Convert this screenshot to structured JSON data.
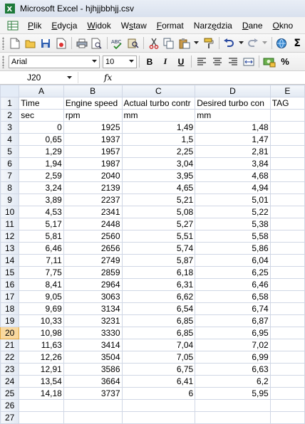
{
  "window": {
    "title": "Microsoft Excel - hjhjjbbhjj.csv"
  },
  "menu": [
    {
      "pre": "",
      "u": "P",
      "post": "lik"
    },
    {
      "pre": "",
      "u": "E",
      "post": "dycja"
    },
    {
      "pre": "",
      "u": "W",
      "post": "idok"
    },
    {
      "pre": "W",
      "u": "s",
      "post": "taw"
    },
    {
      "pre": "",
      "u": "F",
      "post": "ormat"
    },
    {
      "pre": "Narz",
      "u": "ę",
      "post": "dzia"
    },
    {
      "pre": "",
      "u": "D",
      "post": "ane"
    },
    {
      "pre": "",
      "u": "O",
      "post": "kno"
    }
  ],
  "format_toolbar": {
    "font": "Arial",
    "size": "10",
    "bold": "B",
    "italic": "I",
    "underline": "U"
  },
  "formula_bar": {
    "cell_ref": "J20",
    "fx": "fx",
    "content": ""
  },
  "columns": [
    "A",
    "B",
    "C",
    "D",
    "E"
  ],
  "active_row": 20,
  "rows": [
    [
      "Time",
      "Engine speed",
      "Actual turbo contr",
      "Desired turbo con",
      "TAG"
    ],
    [
      "sec",
      "rpm",
      "mm",
      "mm",
      ""
    ],
    [
      "0",
      "1925",
      "1,49",
      "1,48",
      ""
    ],
    [
      "0,65",
      "1937",
      "1,5",
      "1,47",
      ""
    ],
    [
      "1,29",
      "1957",
      "2,25",
      "2,81",
      ""
    ],
    [
      "1,94",
      "1987",
      "3,04",
      "3,84",
      ""
    ],
    [
      "2,59",
      "2040",
      "3,95",
      "4,68",
      ""
    ],
    [
      "3,24",
      "2139",
      "4,65",
      "4,94",
      ""
    ],
    [
      "3,89",
      "2237",
      "5,21",
      "5,01",
      ""
    ],
    [
      "4,53",
      "2341",
      "5,08",
      "5,22",
      ""
    ],
    [
      "5,17",
      "2448",
      "5,27",
      "5,38",
      ""
    ],
    [
      "5,81",
      "2560",
      "5,51",
      "5,58",
      ""
    ],
    [
      "6,46",
      "2656",
      "5,74",
      "5,86",
      ""
    ],
    [
      "7,11",
      "2749",
      "5,87",
      "6,04",
      ""
    ],
    [
      "7,75",
      "2859",
      "6,18",
      "6,25",
      ""
    ],
    [
      "8,41",
      "2964",
      "6,31",
      "6,46",
      ""
    ],
    [
      "9,05",
      "3063",
      "6,62",
      "6,58",
      ""
    ],
    [
      "9,69",
      "3134",
      "6,54",
      "6,74",
      ""
    ],
    [
      "10,33",
      "3231",
      "6,85",
      "6,87",
      ""
    ],
    [
      "10,98",
      "3330",
      "6,85",
      "6,95",
      ""
    ],
    [
      "11,63",
      "3414",
      "7,04",
      "7,02",
      ""
    ],
    [
      "12,26",
      "3504",
      "7,05",
      "6,99",
      ""
    ],
    [
      "12,91",
      "3586",
      "6,75",
      "6,63",
      ""
    ],
    [
      "13,54",
      "3664",
      "6,41",
      "6,2",
      ""
    ],
    [
      "14,18",
      "3737",
      "6",
      "5,95",
      ""
    ],
    [
      "",
      "",
      "",
      "",
      ""
    ],
    [
      "",
      "",
      "",
      "",
      ""
    ]
  ]
}
